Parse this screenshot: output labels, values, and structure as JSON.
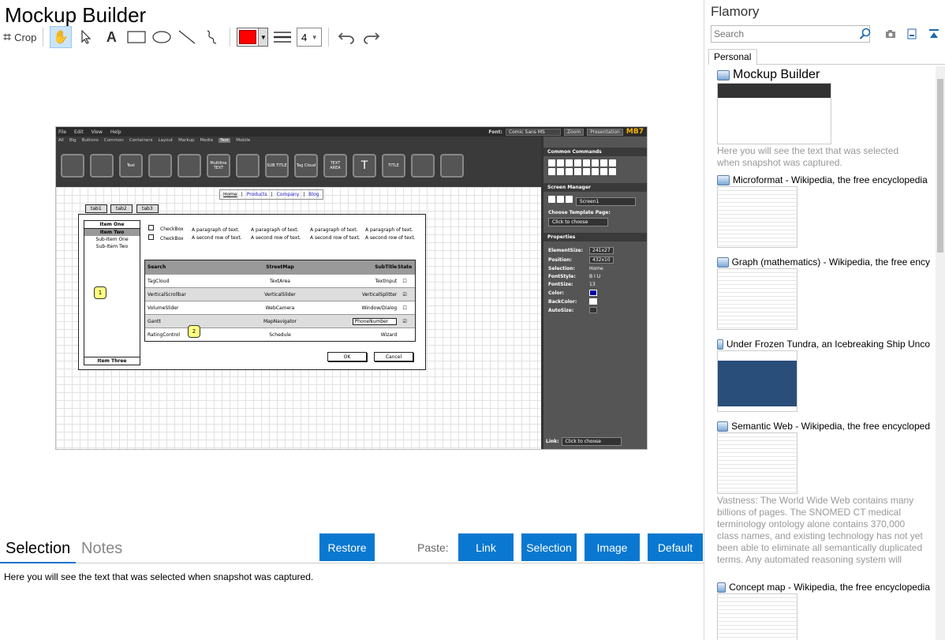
{
  "app": {
    "title": "Mockup Builder"
  },
  "toolbar": {
    "crop_label": "Crop",
    "line_width": "4",
    "color": "#ff0000"
  },
  "screenshot": {
    "menu": [
      "File",
      "Edit",
      "View",
      "Help"
    ],
    "font_label": "Font:",
    "font_value": "Comic Sans MS",
    "zoom_label": "Zoom",
    "presentation_label": "Presentation",
    "logo": "MB7",
    "categories": [
      "All",
      "Big",
      "Buttons",
      "Common",
      "Containers",
      "Layout",
      "Markup",
      "Media",
      "Text",
      "Mobile"
    ],
    "selected_category": "Text",
    "palette": [
      "",
      "",
      "Text",
      "",
      "",
      "Multiline TEXT",
      "",
      "SUB TITLE",
      "Tag Cloud",
      "TEXT AREA",
      "T",
      "TITLE",
      "",
      ""
    ],
    "breadcrumb": [
      "Home",
      "Products",
      "Company",
      "Blog"
    ],
    "tabs": [
      "tab1",
      "tab2",
      "tab3"
    ],
    "list": [
      "Item One",
      "Item Two",
      "Sub-Item One",
      "Sub-Item Two",
      "Item Three"
    ],
    "checkboxes": [
      "CheckBox",
      "CheckBox"
    ],
    "paragraph_1": "A paragraph of text.",
    "paragraph_2": "A second row of text.",
    "table_header": [
      "Search",
      "StreetMap",
      "SubTitle",
      "State"
    ],
    "table_rows": [
      [
        "TagCloud",
        "TextArea",
        "TextInput"
      ],
      [
        "VerticalScrollbar",
        "VerticalSlider",
        "VerticalSplitter"
      ],
      [
        "VolumeSlider",
        "WebCamera",
        "Window/Dialog"
      ],
      [
        "Gantt",
        "MapNavigator",
        "PhoneNumber"
      ],
      [
        "RatingControl",
        "Schedule",
        "Wizard"
      ]
    ],
    "badge_1": "1",
    "badge_2": "2",
    "ok_label": "OK",
    "cancel_label": "Cancel",
    "side": {
      "common_commands": "Common Commands",
      "screen_manager": "Screen Manager",
      "screen_name": "Screen1",
      "choose_template": "Choose Template Page:",
      "click_to_choose": "Click to choose",
      "properties": "Properties",
      "props": [
        [
          "ElementSize:",
          "241x27"
        ],
        [
          "Position:",
          "432x10"
        ],
        [
          "Selection:",
          "Home"
        ],
        [
          "FontStyle:",
          "B I U"
        ],
        [
          "FontSize:",
          "13"
        ],
        [
          "Color:",
          ""
        ],
        [
          "BackColor:",
          ""
        ],
        [
          "AutoSize:",
          ""
        ]
      ],
      "link_label": "Link:",
      "link_value": "Click to choose"
    }
  },
  "bottom": {
    "tab_selection": "Selection",
    "tab_notes": "Notes",
    "restore": "Restore",
    "paste_label": "Paste:",
    "paste_buttons": [
      "Link",
      "Selection",
      "Image",
      "Default"
    ],
    "selection_text": "Here you will see the text that was selected when snapshot was captured."
  },
  "right": {
    "title": "Flamory",
    "search_placeholder": "Search",
    "tab_personal": "Personal",
    "items": [
      {
        "title": "Mockup Builder",
        "desc": "Here you will see the text that was selected when snapshot was captured."
      },
      {
        "title": "Microformat - Wikipedia, the free encyclopedia",
        "desc": ""
      },
      {
        "title": "Graph (mathematics) - Wikipedia, the free ency",
        "desc": ""
      },
      {
        "title": "Under Frozen Tundra, an Icebreaking Ship Unco",
        "desc": ""
      },
      {
        "title": "Semantic Web - Wikipedia, the free encycloped",
        "desc": "Vastness: The World Wide Web contains many billions of pages. The SNOMED CT medical terminology ontology alone contains 370,000 class names, and existing technology has not yet been able to eliminate all semantically duplicated terms. Any automated reasoning system will have to deal with truly huge inputs."
      },
      {
        "title": "Concept map - Wikipedia, the free encyclopedia",
        "desc": ""
      }
    ]
  },
  "colors": {
    "accent": "#0a78d0",
    "selected_tab": "#1a73c9"
  }
}
